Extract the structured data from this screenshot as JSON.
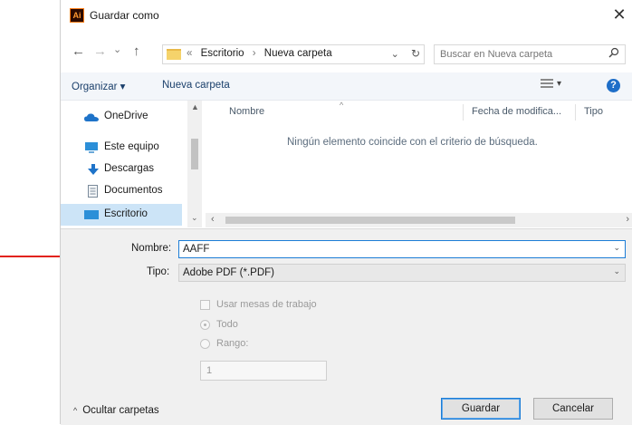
{
  "window": {
    "title": "Guardar como",
    "app_icon_text": "Ai",
    "close_glyph": "✕"
  },
  "nav": {
    "back_glyph": "←",
    "forward_glyph": "→",
    "recent_glyph": "⌄",
    "up_glyph": "↑",
    "breadcrumb_prefix": "«",
    "breadcrumb_sep": "›",
    "breadcrumb": [
      "Escritorio",
      "Nueva carpeta"
    ],
    "address_dropdown_glyph": "⌄",
    "refresh_glyph": "↻",
    "search_placeholder": "Buscar en Nueva carpeta",
    "search_icon": "search-icon"
  },
  "toolbar": {
    "organize_label": "Organizar ▾",
    "new_folder_label": "Nueva carpeta",
    "view_icon": "view-options-icon",
    "view_chevron": "▾",
    "help_glyph": "?"
  },
  "sidebar": {
    "items": [
      {
        "label": "OneDrive",
        "icon": "onedrive-icon",
        "color": "#1e73c9"
      },
      {
        "label": "Este equipo",
        "icon": "computer-icon",
        "color": "#2c8fd8"
      },
      {
        "label": "Descargas",
        "icon": "download-icon",
        "color": "#1e73c9"
      },
      {
        "label": "Documentos",
        "icon": "document-icon",
        "color": "#7a8a9a"
      },
      {
        "label": "Escritorio",
        "icon": "desktop-icon",
        "color": "#2c8fd8"
      }
    ],
    "scroll_up_glyph": "▲",
    "scroll_down_glyph": "⌄"
  },
  "file_list": {
    "columns": [
      "Nombre",
      "Fecha de modifica...",
      "Tipo"
    ],
    "sort_glyph": "^",
    "empty_message": "Ningún elemento coincide con el criterio de búsqueda.",
    "scroll_left_glyph": "‹",
    "scroll_right_glyph": "›"
  },
  "form": {
    "name_label": "Nombre:",
    "name_value": "AAFF",
    "type_label": "Tipo:",
    "type_value": "Adobe PDF (*.PDF)",
    "dropdown_glyph": "⌄",
    "artboards_label": "Usar mesas de trabajo",
    "all_label": "Todo",
    "range_label": "Rango:",
    "range_value": "1"
  },
  "footer": {
    "hide_folders_label": "Ocultar carpetas",
    "hide_folders_glyph": "^",
    "save_label": "Guardar",
    "cancel_label": "Cancelar"
  },
  "colors": {
    "accent": "#1c7dd6",
    "annotation_arrow": "#e2231a",
    "selected_row": "#cce4f7"
  }
}
